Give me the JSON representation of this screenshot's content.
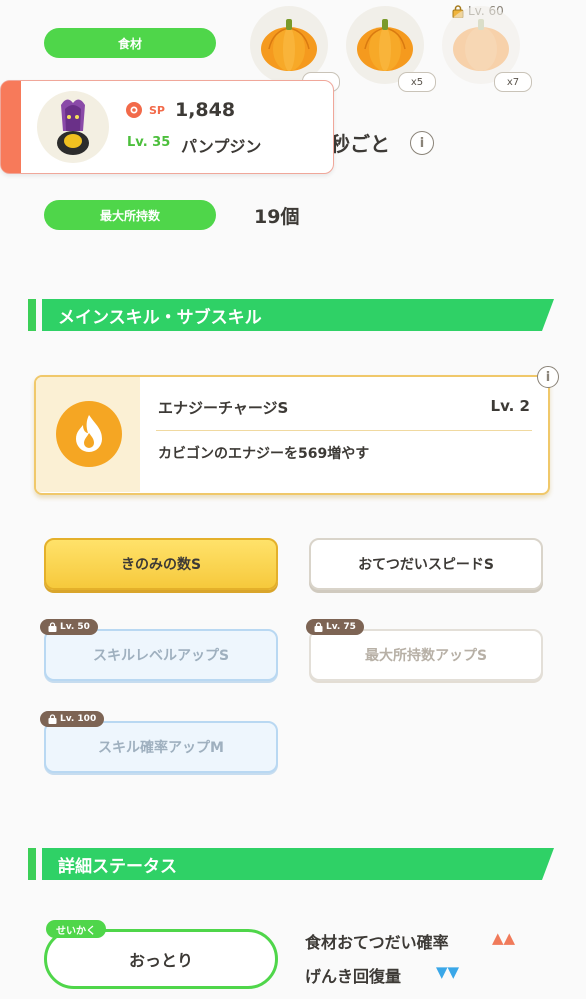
{
  "ingredients": {
    "label": "食材",
    "counts": [
      "",
      "x5",
      "x7"
    ],
    "lock_level": "Lv. 60"
  },
  "pokemon": {
    "sp_label": "SP",
    "strength": "1,848",
    "level": "Lv. 35",
    "name": "パンプジン"
  },
  "help_interval": {
    "suffix": "秒ごと"
  },
  "max_carry": {
    "label": "最大所持数",
    "value": "19個"
  },
  "skills_section": {
    "title": "メインスキル・サブスキル"
  },
  "main_skill": {
    "name": "エナジーチャージS",
    "level": "Lv. 2",
    "description": "カビゴンのエナジーを569増やす"
  },
  "sub_skills": [
    {
      "label": "きのみの数S"
    },
    {
      "label": "おてつだいスピードS"
    },
    {
      "label": "スキルレベルアップS",
      "lock": "Lv. 50"
    },
    {
      "label": "最大所持数アップS",
      "lock": "Lv. 75"
    },
    {
      "label": "スキル確率アップM",
      "lock": "Lv. 100"
    }
  ],
  "details_section": {
    "title": "詳細ステータス"
  },
  "nature": {
    "tag": "せいかく",
    "value": "おっとり",
    "effects": [
      {
        "label": "食材おてつだい確率",
        "arrows": "▲▲",
        "color": "#f07a5a"
      },
      {
        "label": "げんき回復量",
        "arrows": "▼▼",
        "color": "#3aa7e8"
      }
    ]
  },
  "colors": {
    "green": "#2fd166",
    "pill": "#4fd64a",
    "gold": "#f6c93c",
    "coral": "#f77a5a"
  }
}
